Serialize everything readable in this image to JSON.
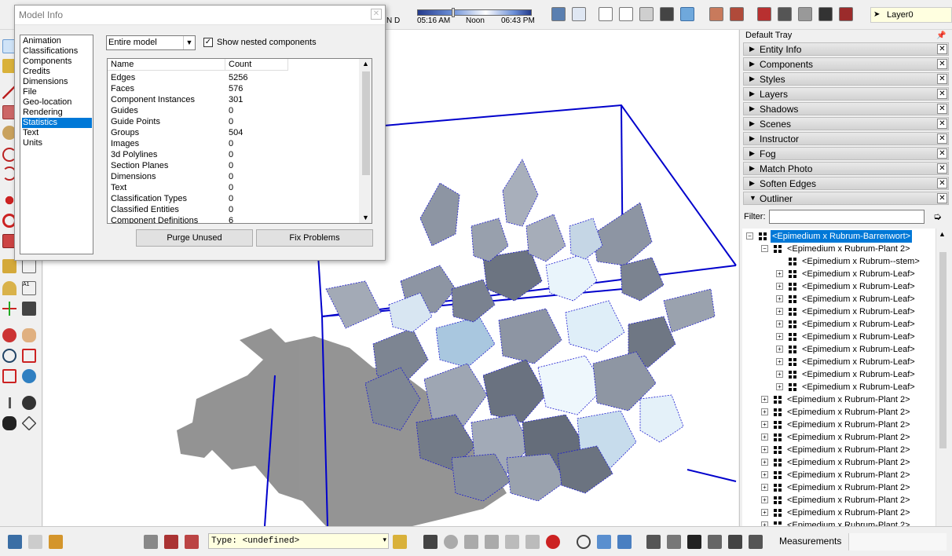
{
  "top": {
    "sun_indicator": "N D",
    "time_start": "05:16 AM",
    "time_noon": "Noon",
    "time_end": "06:43 PM",
    "layer": "Layer0"
  },
  "dialog": {
    "title": "Model Info",
    "categories": [
      "Animation",
      "Classifications",
      "Components",
      "Credits",
      "Dimensions",
      "File",
      "Geo-location",
      "Rendering",
      "Statistics",
      "Text",
      "Units"
    ],
    "selected_category": "Statistics",
    "scope_select": "Entire model",
    "nested_label": "Show nested components",
    "nested_checked": true,
    "col_name": "Name",
    "col_count": "Count",
    "rows": [
      {
        "name": "Edges",
        "count": "5256"
      },
      {
        "name": "Faces",
        "count": "576"
      },
      {
        "name": "Component Instances",
        "count": "301"
      },
      {
        "name": "Guides",
        "count": "0"
      },
      {
        "name": "Guide Points",
        "count": "0"
      },
      {
        "name": "Groups",
        "count": "504"
      },
      {
        "name": "Images",
        "count": "0"
      },
      {
        "name": "3d Polylines",
        "count": "0"
      },
      {
        "name": "Section Planes",
        "count": "0"
      },
      {
        "name": "Dimensions",
        "count": "0"
      },
      {
        "name": "Text",
        "count": "0"
      },
      {
        "name": "Classification Types",
        "count": "0"
      },
      {
        "name": "Classified Entities",
        "count": "0"
      },
      {
        "name": "Component Definitions",
        "count": "6"
      }
    ],
    "purge_label": "Purge Unused",
    "fix_label": "Fix Problems"
  },
  "tray": {
    "title": "Default Tray",
    "panels": [
      {
        "label": "Entity Info",
        "open": false
      },
      {
        "label": "Components",
        "open": false
      },
      {
        "label": "Styles",
        "open": false
      },
      {
        "label": "Layers",
        "open": false
      },
      {
        "label": "Shadows",
        "open": false
      },
      {
        "label": "Scenes",
        "open": false
      },
      {
        "label": "Instructor",
        "open": false
      },
      {
        "label": "Fog",
        "open": false
      },
      {
        "label": "Match Photo",
        "open": false
      },
      {
        "label": "Soften Edges",
        "open": false
      },
      {
        "label": "Outliner",
        "open": true
      }
    ],
    "filter_label": "Filter:",
    "filter_value": "",
    "outliner": [
      {
        "label": "<Epimedium x Rubrum-Barrenwort>",
        "level": 0,
        "expander": "minus",
        "selected": true
      },
      {
        "label": "<Epimedium x Rubrum-Plant 2>",
        "level": 1,
        "expander": "minus"
      },
      {
        "label": "<Epimedium x Rubrum--stem>",
        "level": 2,
        "expander": "none"
      },
      {
        "label": "<Epimedium x Rubrum-Leaf>",
        "level": 2,
        "expander": "plus"
      },
      {
        "label": "<Epimedium x Rubrum-Leaf>",
        "level": 2,
        "expander": "plus"
      },
      {
        "label": "<Epimedium x Rubrum-Leaf>",
        "level": 2,
        "expander": "plus"
      },
      {
        "label": "<Epimedium x Rubrum-Leaf>",
        "level": 2,
        "expander": "plus"
      },
      {
        "label": "<Epimedium x Rubrum-Leaf>",
        "level": 2,
        "expander": "plus"
      },
      {
        "label": "<Epimedium x Rubrum-Leaf>",
        "level": 2,
        "expander": "plus"
      },
      {
        "label": "<Epimedium x Rubrum-Leaf>",
        "level": 2,
        "expander": "plus"
      },
      {
        "label": "<Epimedium x Rubrum-Leaf>",
        "level": 2,
        "expander": "plus"
      },
      {
        "label": "<Epimedium x Rubrum-Leaf>",
        "level": 2,
        "expander": "plus"
      },
      {
        "label": "<Epimedium x Rubrum-Leaf>",
        "level": 2,
        "expander": "plus"
      },
      {
        "label": "<Epimedium x Rubrum-Plant 2>",
        "level": 1,
        "expander": "plus"
      },
      {
        "label": "<Epimedium x Rubrum-Plant 2>",
        "level": 1,
        "expander": "plus"
      },
      {
        "label": "<Epimedium x Rubrum-Plant 2>",
        "level": 1,
        "expander": "plus"
      },
      {
        "label": "<Epimedium x Rubrum-Plant 2>",
        "level": 1,
        "expander": "plus"
      },
      {
        "label": "<Epimedium x Rubrum-Plant 2>",
        "level": 1,
        "expander": "plus"
      },
      {
        "label": "<Epimedium x Rubrum-Plant 2>",
        "level": 1,
        "expander": "plus"
      },
      {
        "label": "<Epimedium x Rubrum-Plant 2>",
        "level": 1,
        "expander": "plus"
      },
      {
        "label": "<Epimedium x Rubrum-Plant 2>",
        "level": 1,
        "expander": "plus"
      },
      {
        "label": "<Epimedium x Rubrum-Plant 2>",
        "level": 1,
        "expander": "plus"
      },
      {
        "label": "<Epimedium x Rubrum-Plant 2>",
        "level": 1,
        "expander": "plus"
      },
      {
        "label": "<Epimedium x Rubrum-Plant 2>",
        "level": 1,
        "expander": "plus"
      }
    ]
  },
  "bottom": {
    "type_field": "Type: <undefined>",
    "measurements_label": "Measurements"
  },
  "colors": {
    "selection": "#0078d7",
    "bounding_box": "#0000cc",
    "leaf_fill": "#9aa3b5",
    "shadow": "#8c8c8c"
  }
}
